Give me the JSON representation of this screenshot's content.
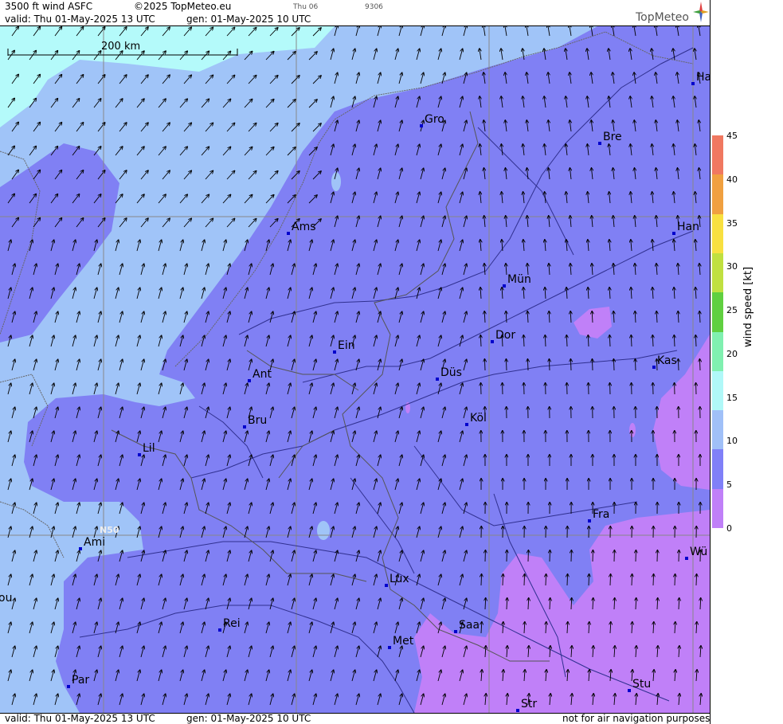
{
  "header": {
    "product": "3500 ft wind ASFC",
    "copyright": "©2025 TopMeteo.eu",
    "day_small": "Thu 06",
    "code_small": "9306",
    "valid": "valid:  Thu  01-May-2025  13 UTC",
    "gen": "gen: 01-May-2025 10 UTC",
    "logo": "TopMeteo"
  },
  "footer": {
    "valid": "valid:  Thu  01-May-2025  13 UTC",
    "gen": "gen: 01-May-2025 10 UTC",
    "disclaimer": "not for air navigation purposes"
  },
  "scale": {
    "label": "200 km"
  },
  "grid_label": "N50",
  "cities": {
    "ham": "Ha",
    "gro": "Gro",
    "bre": "Bre",
    "ams": "Ams",
    "han": "Han",
    "mun": "Mün",
    "dor": "Dor",
    "ein": "Ein",
    "kas": "Kas",
    "ant": "Ant",
    "dus": "Düs",
    "bru": "Bru",
    "kol": "Köl",
    "lil": "Lil",
    "fra": "Fra",
    "ami": "Ami",
    "wur": "Wü",
    "lux": "Lux",
    "bou": "ou",
    "rei": "Rei",
    "saa": "Saa",
    "met": "Met",
    "stu": "Stu",
    "par": "Par",
    "str": "Str"
  },
  "legend": {
    "title": "wind speed [kt]",
    "ticks": [
      "45",
      "40",
      "35",
      "30",
      "25",
      "20",
      "15",
      "10",
      "5",
      "0"
    ],
    "colors": [
      "#f07860",
      "#f0a040",
      "#f8e040",
      "#c0e040",
      "#60d040",
      "#80f0b0",
      "#b0f8f8",
      "#a0c0f8",
      "#8080f8",
      "#c080f8"
    ]
  },
  "wind_colors": {
    "cyan": "#b4fafa",
    "light_blue": "#a0c4f8",
    "blue": "#8080f4",
    "purple": "#c080f8"
  }
}
